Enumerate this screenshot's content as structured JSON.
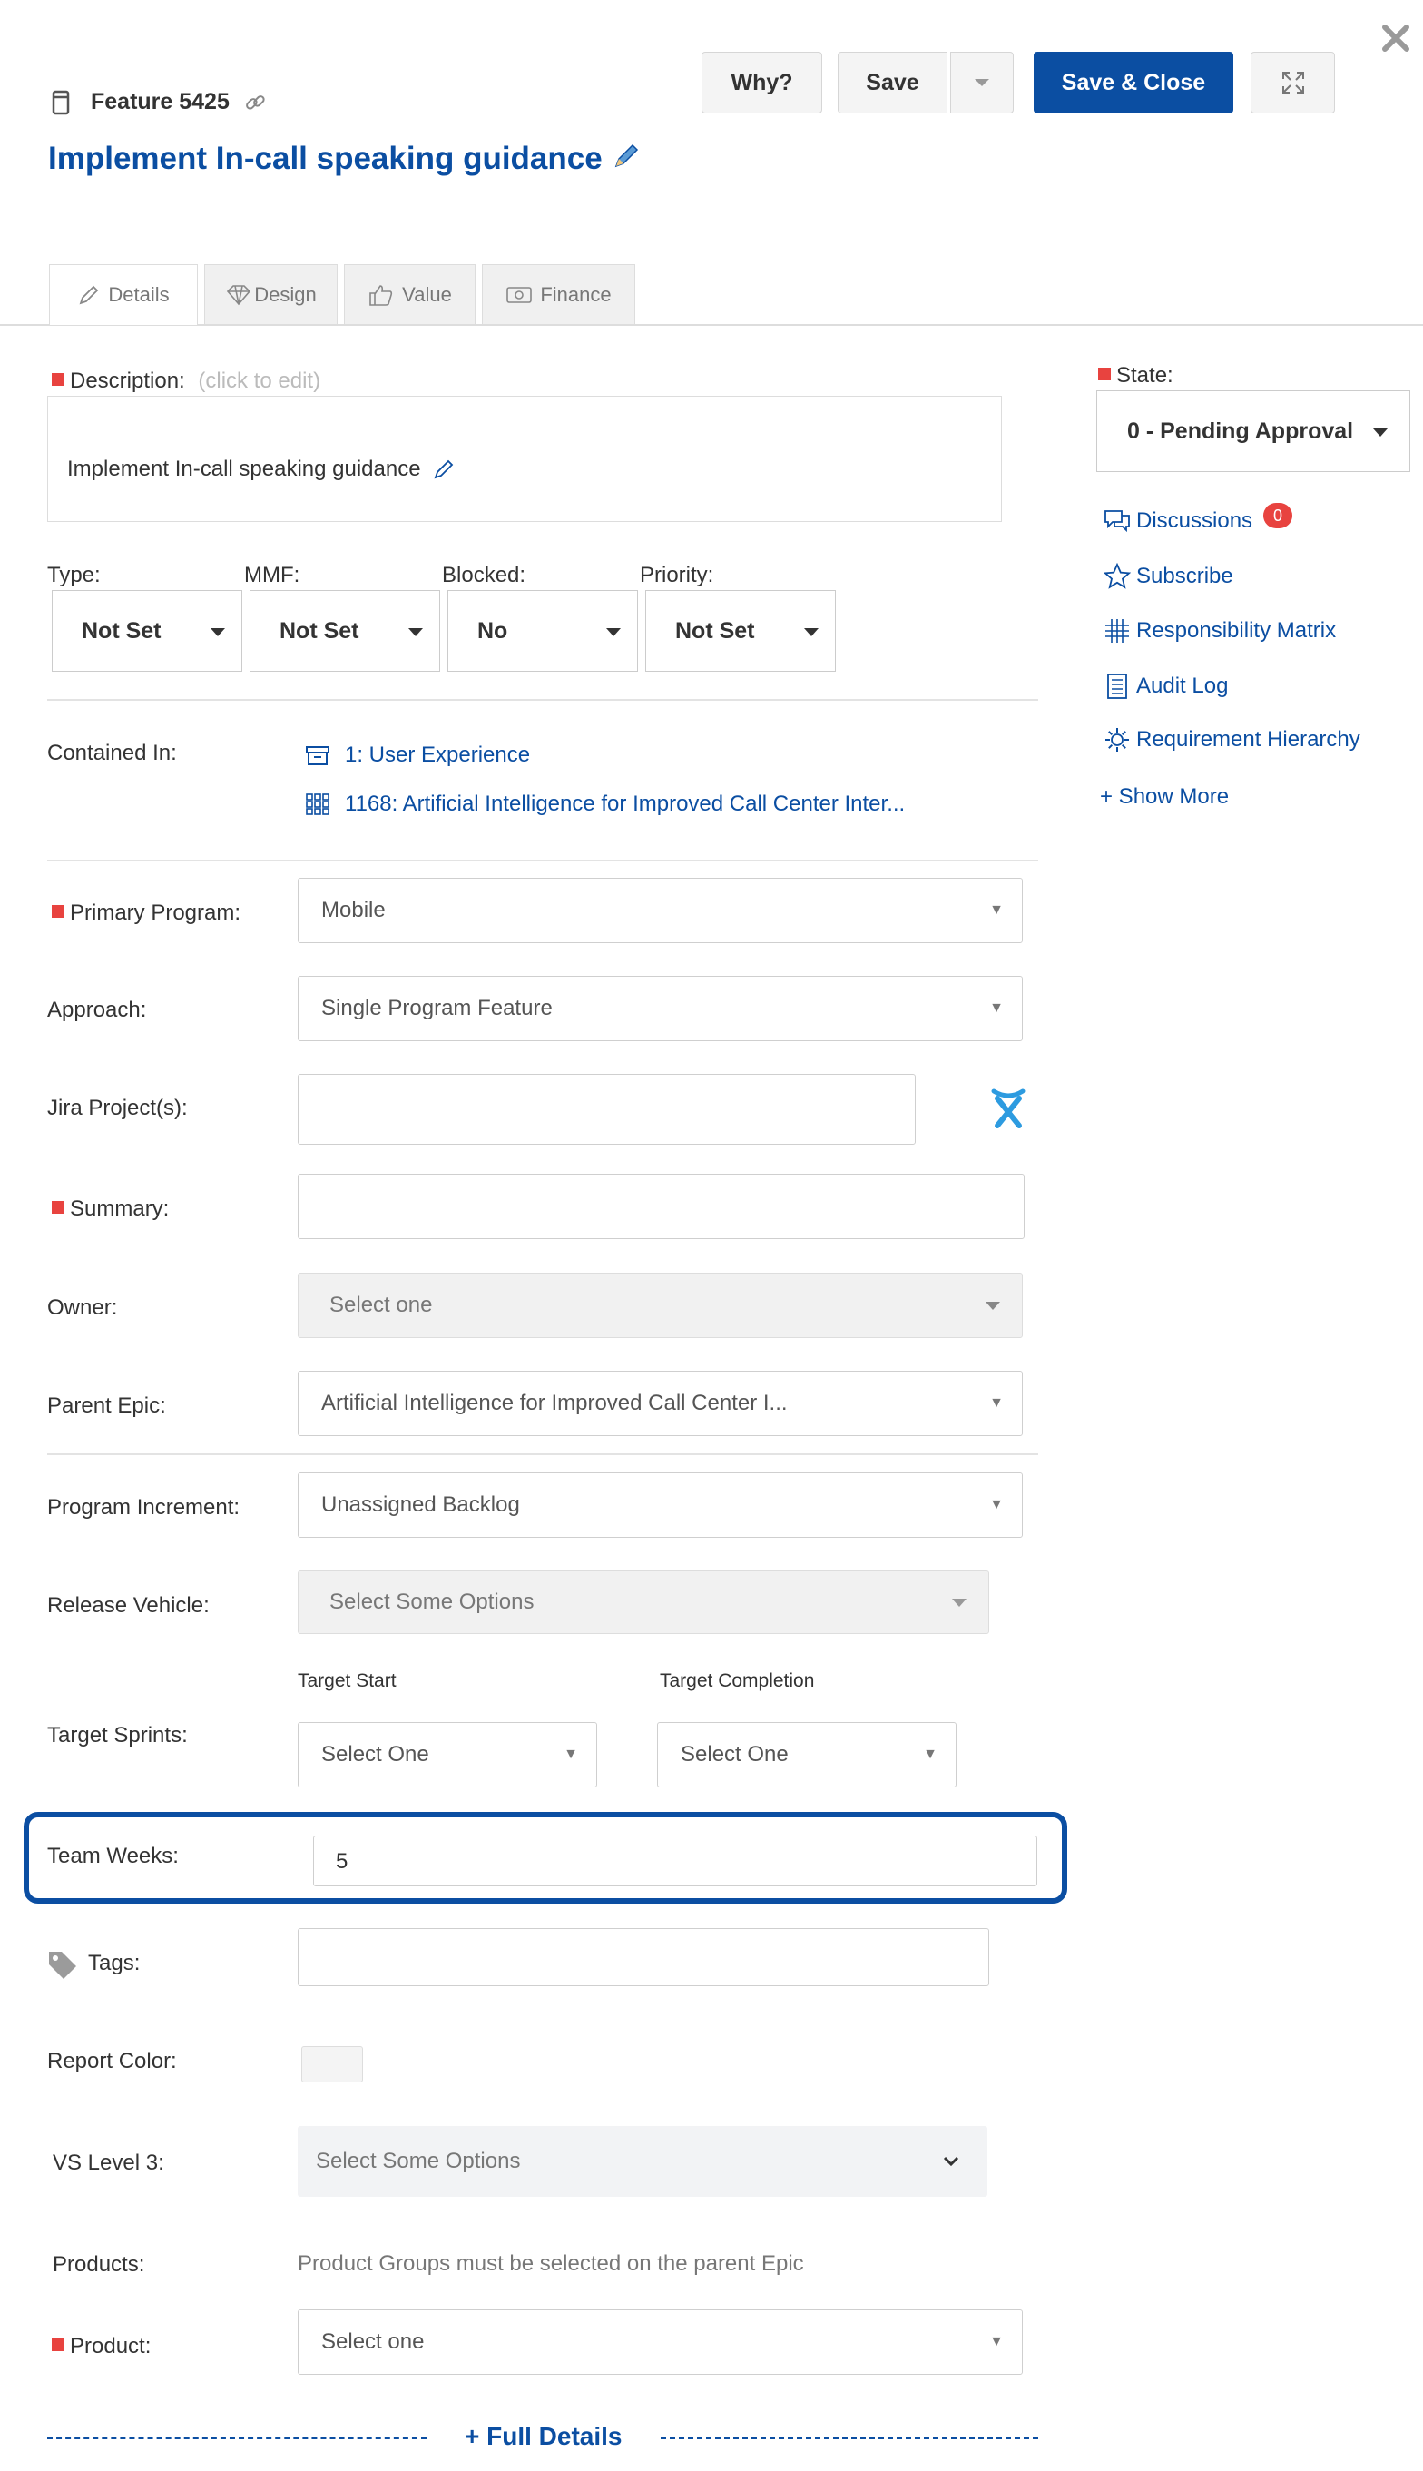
{
  "header": {
    "item_ref": "Feature 5425",
    "title": "Implement In-call speaking guidance",
    "buttons": {
      "why": "Why?",
      "save": "Save",
      "save_close": "Save & Close"
    }
  },
  "tabs": [
    {
      "label": "Details"
    },
    {
      "label": "Design"
    },
    {
      "label": "Value"
    },
    {
      "label": "Finance"
    }
  ],
  "description": {
    "label": "Description:",
    "hint": "(click to edit)",
    "text": "Implement In-call speaking guidance"
  },
  "quick_fields": {
    "type": {
      "label": "Type:",
      "value": "Not Set"
    },
    "mmf": {
      "label": "MMF:",
      "value": "Not Set"
    },
    "blocked": {
      "label": "Blocked:",
      "value": "No"
    },
    "priority": {
      "label": "Priority:",
      "value": "Not Set"
    }
  },
  "contained_in": {
    "label": "Contained In:",
    "items": [
      "1: User Experience",
      "1168: Artificial Intelligence for Improved Call Center Inter..."
    ]
  },
  "fields": {
    "primary_program": {
      "label": "Primary Program:",
      "value": "Mobile"
    },
    "approach": {
      "label": "Approach:",
      "value": "Single Program Feature"
    },
    "jira_projects": {
      "label": "Jira Project(s):",
      "value": ""
    },
    "summary": {
      "label": "Summary:",
      "value": ""
    },
    "owner": {
      "label": "Owner:",
      "placeholder": "Select one"
    },
    "parent_epic": {
      "label": "Parent Epic:",
      "value": "Artificial Intelligence for Improved Call Center I..."
    },
    "program_increment": {
      "label": "Program Increment:",
      "value": "Unassigned Backlog"
    },
    "release_vehicle": {
      "label": "Release Vehicle:",
      "placeholder": "Select Some Options"
    },
    "target_sprints": {
      "label": "Target Sprints:",
      "start_label": "Target Start",
      "completion_label": "Target Completion",
      "start_value": "Select One",
      "completion_value": "Select One"
    },
    "team_weeks": {
      "label": "Team Weeks:",
      "value": "5"
    },
    "tags": {
      "label": "Tags:",
      "value": ""
    },
    "report_color": {
      "label": "Report Color:"
    },
    "vs_level_3": {
      "label": "VS Level 3:",
      "placeholder": "Select Some Options"
    },
    "products": {
      "label": "Products:",
      "note": "Product Groups must be selected on the parent Epic"
    },
    "product": {
      "label": "Product:",
      "value": "Select one"
    }
  },
  "footer": {
    "full_details": "+ Full Details"
  },
  "sidebar": {
    "state_label": "State:",
    "state_value": "0 - Pending Approval",
    "links": {
      "discussions": "Discussions",
      "discussions_count": "0",
      "subscribe": "Subscribe",
      "responsibility_matrix": "Responsibility Matrix",
      "audit_log": "Audit Log",
      "requirement_hierarchy": "Requirement Hierarchy",
      "show_more": "+ Show More"
    }
  },
  "colors": {
    "accent": "#0b4ea2",
    "required": "#e8433f",
    "badge": "#e8433f"
  }
}
